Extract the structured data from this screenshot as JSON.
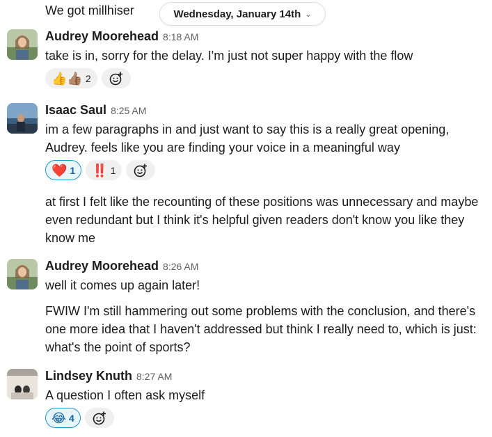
{
  "previous_message": "We got millhiser",
  "date_divider": {
    "label": "Wednesday, January 14th",
    "chevron": "chevron-down-icon"
  },
  "messages": [
    {
      "sender": "Audrey Moorehead",
      "time": "8:18 AM",
      "texts": [
        "take is in, sorry for the delay. I'm just not super happy with the flow"
      ],
      "reactions": [
        {
          "emoji": "👍👍🏽",
          "count": "2",
          "active": false
        }
      ]
    },
    {
      "sender": "Isaac Saul",
      "time": "8:25 AM",
      "texts": [
        "im a few paragraphs in and just want to say this is a really great opening, Audrey. feels like you are finding your voice in a meaningful way",
        "at first I felt like the recounting of these positions was unnecessary and maybe even redundant but I think it's helpful given readers don't know you like they know me"
      ],
      "reactions": [
        {
          "emoji": "❤️",
          "count": "1",
          "active": true
        },
        {
          "emoji": "‼️",
          "count": "1",
          "active": false
        }
      ]
    },
    {
      "sender": "Audrey Moorehead",
      "time": "8:26 AM",
      "texts": [
        "well it comes up again later!",
        "FWIW I'm still hammering out some problems with the conclusion, and there's one more idea that I haven't addressed but think I really need to, which is just: what's the point of sports?"
      ],
      "reactions": []
    },
    {
      "sender": "Lindsey Knuth",
      "time": "8:27 AM",
      "texts": [
        "A question I often ask myself"
      ],
      "reactions": [
        {
          "emoji": "😂",
          "count": "4",
          "active": true
        }
      ]
    }
  ],
  "colors": {
    "accent": "#1d9bd1",
    "active_bg": "#e8f5fa",
    "pill_bg": "#f0f0f0",
    "muted": "#616061"
  }
}
